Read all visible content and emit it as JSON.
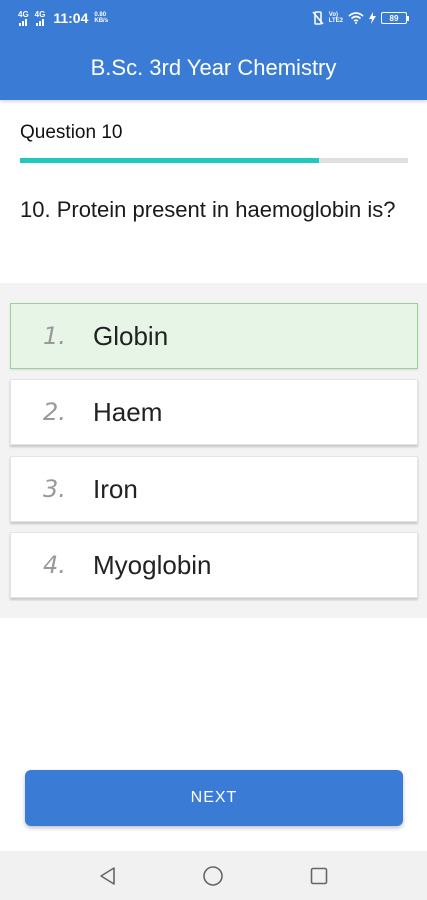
{
  "status_bar": {
    "network1": "4G",
    "network2": "4G",
    "time": "11:04",
    "speed_value": "0.80",
    "speed_unit": "KB/s",
    "volte_top": "Vo)",
    "volte_bottom": "LTE2",
    "battery": "89"
  },
  "app_bar": {
    "title": "B.Sc. 3rd Year Chemistry"
  },
  "quiz": {
    "header": "Question 10",
    "progress": 0.77,
    "question": "10. Protein present in haemoglobin is?",
    "options": [
      {
        "number": "1.",
        "text": "Globin"
      },
      {
        "number": "2.",
        "text": "Haem"
      },
      {
        "number": "3.",
        "text": "Iron"
      },
      {
        "number": "4.",
        "text": "Myoglobin"
      }
    ],
    "next_label": "NEXT"
  },
  "colors": {
    "primary": "#3a7bd5",
    "progress": "#20c9c0",
    "correct_bg": "#e6f5e6"
  },
  "icons": {
    "back": "triangle-back-icon",
    "home": "circle-home-icon",
    "recents": "square-recents-icon"
  }
}
